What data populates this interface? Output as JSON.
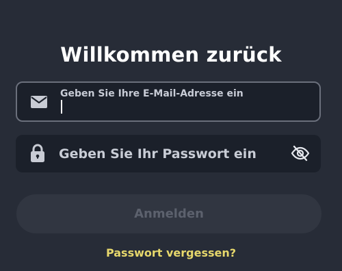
{
  "colors": {
    "background": "#272c37",
    "field_background": "#1b202a",
    "focused_border": "#6b707c",
    "button_background": "#313641",
    "button_text": "#5c616d",
    "link": "#e7d86c"
  },
  "header": {
    "title": "Willkommen zurück"
  },
  "email": {
    "icon": "mail-icon",
    "label": "Geben Sie Ihre E-Mail-Adresse ein",
    "value": ""
  },
  "password": {
    "icon": "lock-icon",
    "placeholder": "Geben Sie Ihr Passwort ein",
    "visibility_icon": "eye-slash-icon",
    "value": ""
  },
  "actions": {
    "login_label": "Anmelden",
    "forgot_password": "Passwort vergessen?"
  }
}
